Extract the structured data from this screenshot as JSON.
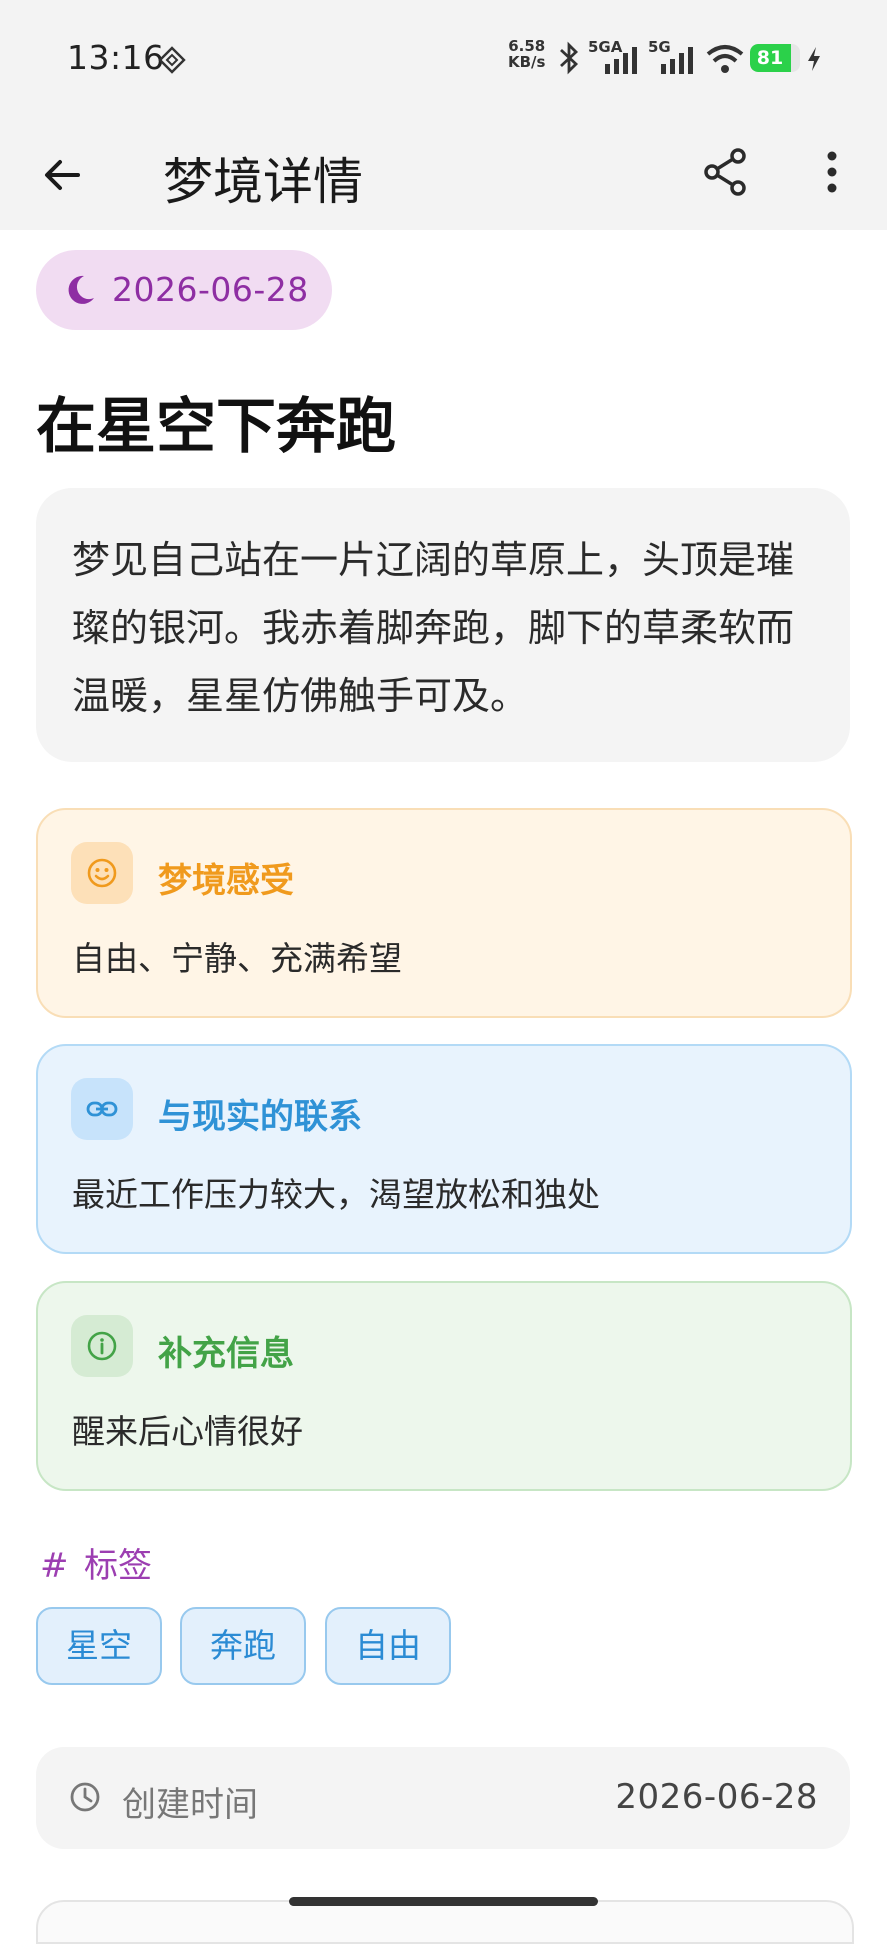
{
  "status_bar": {
    "time": "13:16",
    "net_speed_value": "6.58",
    "net_speed_unit": "KB/s",
    "sim1": "5GA",
    "sim2": "5G",
    "battery": "81",
    "battery_level_percent": 81,
    "icons": [
      "nfc-icon",
      "bluetooth-icon",
      "signal-icon",
      "wifi-icon",
      "battery-icon",
      "charging-icon"
    ]
  },
  "app_bar": {
    "title": "梦境详情",
    "back_icon": "arrow-left-icon",
    "share_icon": "share-icon",
    "more_icon": "more-vertical-icon"
  },
  "dream": {
    "date": "2026-06-28",
    "date_icon": "moon-icon",
    "title": "在星空下奔跑",
    "description": "梦见自己站在一片辽阔的草原上，头顶是璀璨的银河。我赤着脚奔跑，脚下的草柔软而温暖，星星仿佛触手可及。"
  },
  "sections": {
    "feeling": {
      "label": "梦境感受",
      "value": "自由、宁静、充满希望",
      "icon": "smile-icon",
      "color": "#f09a1d"
    },
    "reality": {
      "label": "与现实的联系",
      "value": "最近工作压力较大，渴望放松和独处",
      "icon": "link-icon",
      "color": "#2f92d6"
    },
    "extra": {
      "label": "补充信息",
      "value": "醒来后心情很好",
      "icon": "info-icon",
      "color": "#43a347"
    }
  },
  "tags": {
    "header": "标签",
    "icon": "hash-icon",
    "items": [
      "星空",
      "奔跑",
      "自由"
    ]
  },
  "meta": {
    "created_label": "创建时间",
    "created_value": "2026-06-28",
    "icon": "clock-icon"
  }
}
